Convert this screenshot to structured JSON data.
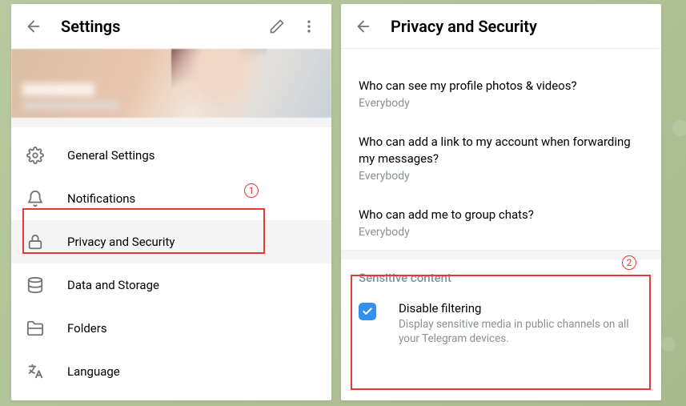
{
  "settings": {
    "title": "Settings",
    "items": [
      {
        "icon": "gear-icon",
        "label": "General Settings"
      },
      {
        "icon": "bell-icon",
        "label": "Notifications"
      },
      {
        "icon": "lock-icon",
        "label": "Privacy and Security"
      },
      {
        "icon": "database-icon",
        "label": "Data and Storage"
      },
      {
        "icon": "folder-icon",
        "label": "Folders"
      },
      {
        "icon": "language-icon",
        "label": "Language"
      }
    ]
  },
  "privacy": {
    "title": "Privacy and Security",
    "items": [
      {
        "title": "Who can see my profile photos & videos?",
        "value": "Everybody"
      },
      {
        "title": "Who can add a link to my account when forwarding my messages?",
        "value": "Everybody"
      },
      {
        "title": "Who can add me to group chats?",
        "value": "Everybody"
      }
    ],
    "sensitive": {
      "section": "Sensitive content",
      "check_label": "Disable filtering",
      "check_desc": "Display sensitive media in public channels on all your Telegram devices.",
      "checked": true
    }
  },
  "annotations": {
    "one": "1",
    "two": "2"
  }
}
